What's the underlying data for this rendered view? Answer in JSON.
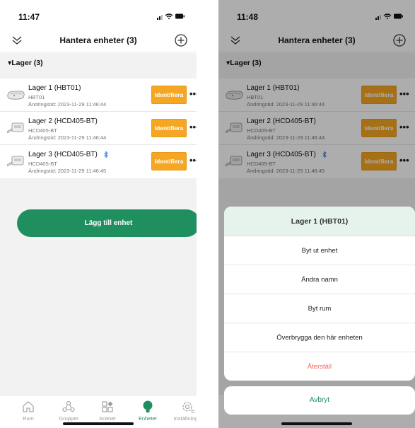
{
  "left": {
    "time": "11:47",
    "title": "Hantera enheter (3)",
    "group": "▾Lager (3)",
    "identify_label": "Identifiera",
    "more_label": "•••",
    "devices": [
      {
        "name": "Lager 1 (HBT01)",
        "model": "HBT01",
        "time": "Ändringstid: 2023-11-29 11:46:44"
      },
      {
        "name": "Lager 2 (HCD405-BT)",
        "model": "HCD405-BT",
        "time": "Ändringstid: 2023-11-29 11:46:44"
      },
      {
        "name": "Lager 3 (HCD405-BT)",
        "model": "HCD405-BT",
        "time": "Ändringstid: 2023-11-29 11:46:45"
      }
    ],
    "add_button": "Lägg till enhet",
    "tabs": [
      {
        "label": "Rum",
        "icon": "home-icon"
      },
      {
        "label": "Grupper",
        "icon": "groups-icon"
      },
      {
        "label": "Scener",
        "icon": "scenes-icon"
      },
      {
        "label": "Enheter",
        "icon": "bulb-icon",
        "active": true
      },
      {
        "label": "Inställningar",
        "icon": "settings-icon"
      }
    ]
  },
  "right": {
    "time": "11:48",
    "title": "Hantera enheter (3)",
    "group": "▾Lager (3)",
    "identify_label": "Identifiera",
    "more_label": "•••",
    "devices": [
      {
        "name": "Lager 1 (HBT01)",
        "model": "HBT01",
        "time": "Ändringstid: 2023-11-29 11:46:44"
      },
      {
        "name": "Lager 2 (HCD405-BT)",
        "model": "HCD405-BT",
        "time": "Ändringstid: 2023-11-29 11:46:44"
      },
      {
        "name": "Lager 3 (HCD405-BT)",
        "model": "HCD405-BT",
        "time": "Ändringstid: 2023-11-29 11:46:45"
      }
    ],
    "sheet": {
      "title": "Lager 1 (HBT01)",
      "items": [
        "Byt ut enhet",
        "Ändra namn",
        "Byt rum",
        "Överbrygga den här enheten",
        "Återställ"
      ],
      "cancel": "Avbryt"
    }
  },
  "colors": {
    "accent": "#1f8f5f",
    "identify": "#f5a623",
    "danger": "#f0685d"
  }
}
